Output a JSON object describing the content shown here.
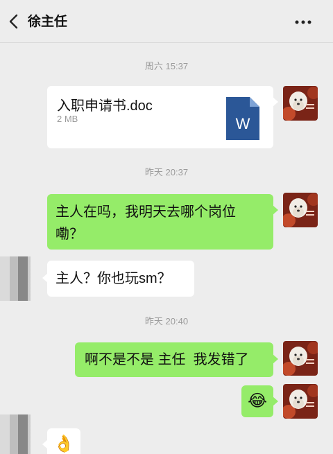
{
  "header": {
    "title": "徐主任",
    "back_icon": "chevron-left-icon",
    "more_icon": "more-dots-icon"
  },
  "messages": {
    "ts1": "周六 15:37",
    "file": {
      "name": "入职申请书.doc",
      "size": "2 MB",
      "icon": "word-doc-icon"
    },
    "ts2": "昨天 20:37",
    "sent1_line1": "主人在吗，我明天去哪个岗位",
    "sent1_line2": "嘞？",
    "recv1": "主人？你也玩sm？",
    "ts3": "昨天 20:40",
    "sent2": "啊不是不是 主任  我发错了",
    "sent3_emoji": "😂",
    "recv2_emoji": "👌"
  },
  "colors": {
    "sent_bubble": "#95ec69",
    "recv_bubble": "#ffffff",
    "background": "#ededed",
    "timestamp": "#9b9b9b"
  }
}
